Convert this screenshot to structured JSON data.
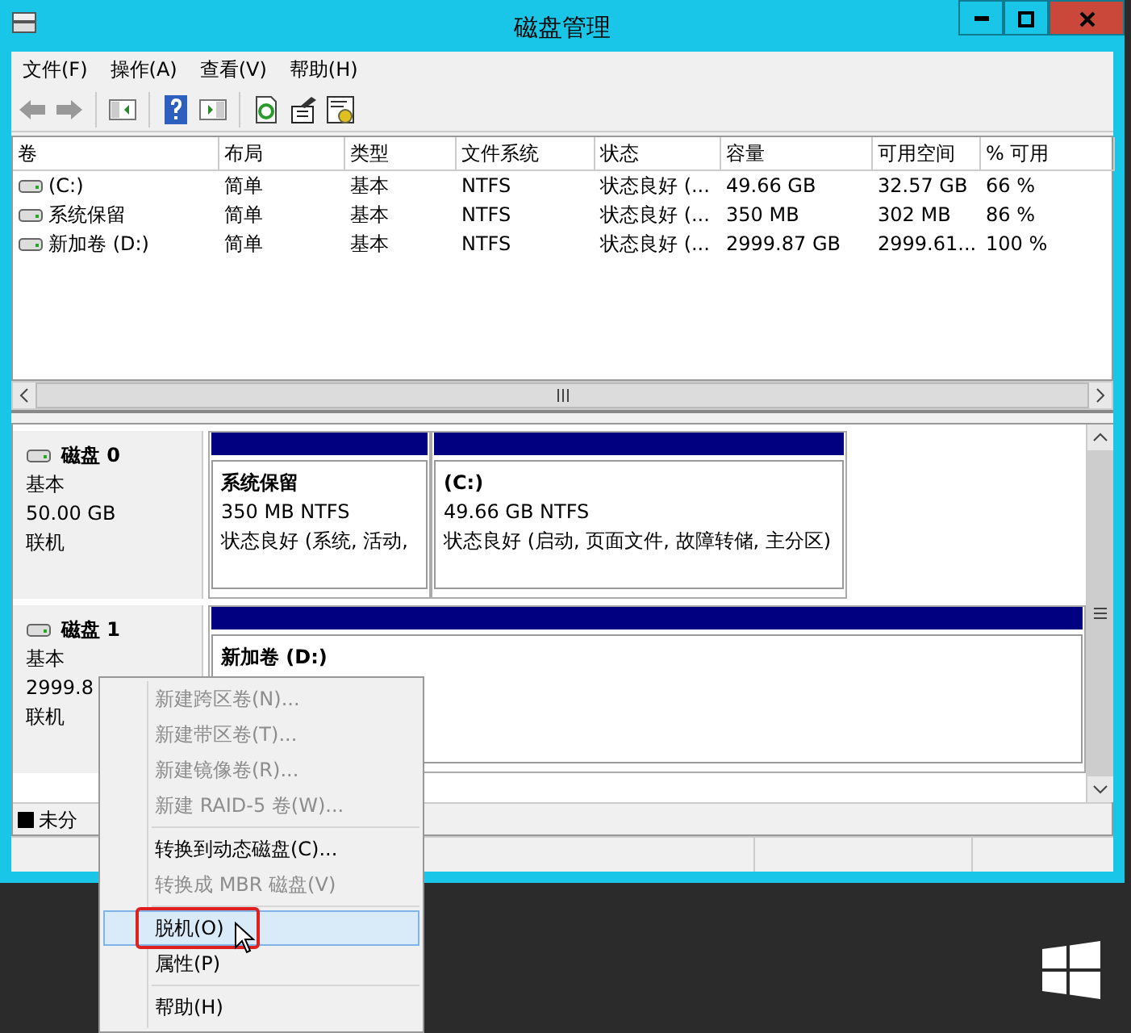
{
  "window": {
    "title": "磁盘管理"
  },
  "menu": [
    "文件(F)",
    "操作(A)",
    "查看(V)",
    "帮助(H)"
  ],
  "volume_table": {
    "columns": [
      "卷",
      "布局",
      "类型",
      "文件系统",
      "状态",
      "容量",
      "可用空间",
      "% 可用"
    ],
    "rows": [
      [
        "(C:)",
        "简单",
        "基本",
        "NTFS",
        "状态良好 (...",
        "49.66 GB",
        "32.57 GB",
        "66 %"
      ],
      [
        "系统保留",
        "简单",
        "基本",
        "NTFS",
        "状态良好 (...",
        "350 MB",
        "302 MB",
        "86 %"
      ],
      [
        "新加卷 (D:)",
        "简单",
        "基本",
        "NTFS",
        "状态良好 (...",
        "2999.87 GB",
        "2999.61...",
        "100 %"
      ]
    ]
  },
  "disks": [
    {
      "name": "磁盘 0",
      "type": "基本",
      "size": "50.00 GB",
      "status": "联机",
      "partitions": [
        {
          "name": "系统保留",
          "detail": "350 MB NTFS",
          "status": "状态良好 (系统, 活动,"
        },
        {
          "name": "(C:)",
          "detail": "49.66 GB NTFS",
          "status": "状态良好 (启动, 页面文件, 故障转储, 主分区)"
        }
      ]
    },
    {
      "name": "磁盘 1",
      "type": "基本",
      "size": "2999.8",
      "status": "联机",
      "partitions": [
        {
          "name": "新加卷  (D:)"
        }
      ]
    }
  ],
  "legend": {
    "label": "未分"
  },
  "context_menu": [
    {
      "kind": "item",
      "label": "新建跨区卷(N)...",
      "disabled": true,
      "selected": false
    },
    {
      "kind": "item",
      "label": "新建带区卷(T)...",
      "disabled": true,
      "selected": false
    },
    {
      "kind": "item",
      "label": "新建镜像卷(R)...",
      "disabled": true,
      "selected": false
    },
    {
      "kind": "item",
      "label": "新建 RAID-5 卷(W)...",
      "disabled": true,
      "selected": false
    },
    {
      "kind": "separator"
    },
    {
      "kind": "item",
      "label": "转换到动态磁盘(C)...",
      "disabled": false,
      "selected": false
    },
    {
      "kind": "item",
      "label": "转换成 MBR 磁盘(V)",
      "disabled": true,
      "selected": false
    },
    {
      "kind": "separator"
    },
    {
      "kind": "item",
      "label": "脱机(O)",
      "disabled": false,
      "selected": true
    },
    {
      "kind": "item",
      "label": "属性(P)",
      "disabled": false,
      "selected": false
    },
    {
      "kind": "separator"
    },
    {
      "kind": "item",
      "label": "帮助(H)",
      "disabled": false,
      "selected": false
    }
  ]
}
